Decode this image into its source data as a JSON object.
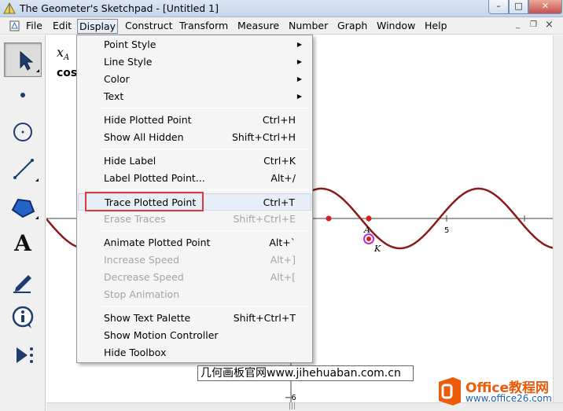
{
  "window": {
    "title": "The Geometer's Sketchpad - [Untitled 1]",
    "min_glyph": "–",
    "max_glyph": "□",
    "close_glyph": "✕"
  },
  "menubar": {
    "items": [
      "File",
      "Edit",
      "Display",
      "Construct",
      "Transform",
      "Measure",
      "Number",
      "Graph",
      "Window",
      "Help"
    ],
    "open_item": "Display",
    "mdi_min": "_",
    "mdi_restore": "❐",
    "mdi_close": "×"
  },
  "toolbox": {
    "tools": [
      "arrow-tool",
      "point-tool",
      "compass-tool",
      "straightedge-tool",
      "polygon-tool",
      "text-tool",
      "marker-tool",
      "information-tool",
      "custom-tool"
    ],
    "text_tool_glyph": "A",
    "selected": "arrow-tool"
  },
  "canvas": {
    "measure_label": "x",
    "measure_sub": "A",
    "measure_label_2": "cos",
    "point_label_a": "A",
    "point_label_k": "K",
    "x_tick_5": "5",
    "y_tick_neg6": "−6",
    "curve_color": "#8b1a1a",
    "point_color": "#d42020",
    "trace_point_color": "#c030c0"
  },
  "dropdown": {
    "groups": [
      [
        {
          "label": "Point Style",
          "submenu": true
        },
        {
          "label": "Line Style",
          "submenu": true
        },
        {
          "label": "Color",
          "submenu": true
        },
        {
          "label": "Text",
          "submenu": true
        }
      ],
      [
        {
          "label": "Hide Plotted Point",
          "shortcut": "Ctrl+H"
        },
        {
          "label": "Show All Hidden",
          "shortcut": "Shift+Ctrl+H"
        }
      ],
      [
        {
          "label": "Hide Label",
          "shortcut": "Ctrl+K"
        },
        {
          "label": "Label Plotted Point...",
          "shortcut": "Alt+/"
        }
      ],
      [
        {
          "label": "Trace Plotted Point",
          "shortcut": "Ctrl+T",
          "highlighted": true
        },
        {
          "label": "Erase Traces",
          "shortcut": "Shift+Ctrl+E",
          "disabled": true
        }
      ],
      [
        {
          "label": "Animate Plotted Point",
          "shortcut": "Alt+`"
        },
        {
          "label": "Increase Speed",
          "shortcut": "Alt+]",
          "disabled": true
        },
        {
          "label": "Decrease Speed",
          "shortcut": "Alt+[",
          "disabled": true
        },
        {
          "label": "Stop Animation",
          "disabled": true
        }
      ],
      [
        {
          "label": "Show Text Palette",
          "shortcut": "Shift+Ctrl+T"
        },
        {
          "label": "Show Motion Controller"
        },
        {
          "label": "Hide Toolbox"
        }
      ]
    ],
    "highlight_color": "#e0393b",
    "submenu_arrow": "▶"
  },
  "watermarks": {
    "site_text": "几何画板官网www.jihehuaban.com.cn",
    "office_brand": "Office教程网",
    "office_url": "www.office26.com"
  }
}
